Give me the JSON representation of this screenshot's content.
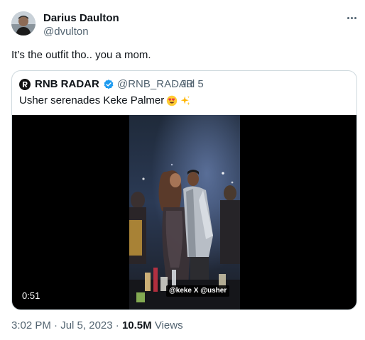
{
  "author": {
    "name": "Darius Daulton",
    "handle": "@dvulton"
  },
  "tweet_text": "It’s the outfit tho.. you a mom.",
  "quoted": {
    "name": "RNB RADAR",
    "handle": "@RNB_RADAR",
    "separator": "·",
    "date": "Jul 5",
    "text": "Usher serenades Keke Palmer",
    "emojis": [
      "heart-eyes-icon",
      "sparkles-icon"
    ],
    "video": {
      "duration": "0:51",
      "caption": "@keke X @usher"
    }
  },
  "meta": {
    "time": "3:02 PM",
    "separator": "·",
    "date": "Jul 5, 2023",
    "views_count": "10.5M",
    "views_label": "Views"
  },
  "colors": {
    "text": "#0f1419",
    "secondary": "#536471",
    "border": "#cfd9de",
    "verified": "#1d9bf0"
  }
}
